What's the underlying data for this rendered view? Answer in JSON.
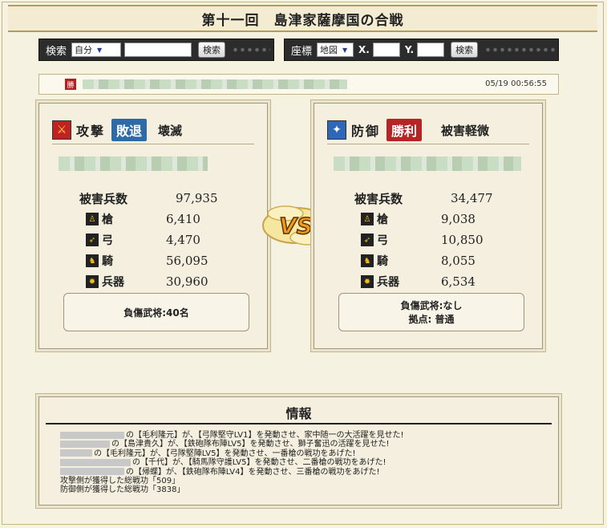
{
  "title": "第十一回　島津家薩摩国の合戦",
  "search": {
    "label": "検索",
    "select_value": "自分",
    "button": "検索"
  },
  "coord_search": {
    "label": "座標",
    "select_value": "地図",
    "x_label": "X.",
    "y_label": "Y.",
    "button": "検索"
  },
  "result_line": {
    "badge": "勝",
    "timestamp": "05/19 00:56:55"
  },
  "attack": {
    "label": "攻撃",
    "result": "敗退",
    "status": "壊滅",
    "result_color": "#2d6aa8",
    "casualties_label": "被害兵数",
    "casualties": "97,935",
    "units": [
      {
        "icon": "spear-icon",
        "name": "槍",
        "value": "6,410"
      },
      {
        "icon": "bow-icon",
        "name": "弓",
        "value": "4,470"
      },
      {
        "icon": "horse-icon",
        "name": "騎",
        "value": "56,095"
      },
      {
        "icon": "siege-icon",
        "name": "兵器",
        "value": "30,960"
      }
    ],
    "injured": "負傷武将:40名"
  },
  "defense": {
    "label": "防御",
    "result": "勝利",
    "status": "被害軽微",
    "result_color": "#b52525",
    "casualties_label": "被害兵数",
    "casualties": "34,477",
    "units": [
      {
        "icon": "spear-icon",
        "name": "槍",
        "value": "9,038"
      },
      {
        "icon": "bow-icon",
        "name": "弓",
        "value": "10,850"
      },
      {
        "icon": "horse-icon",
        "name": "騎",
        "value": "8,055"
      },
      {
        "icon": "siege-icon",
        "name": "兵器",
        "value": "6,534"
      }
    ],
    "injured": "負傷武将:なし",
    "base": "拠点: 普通"
  },
  "vs_text": "VS",
  "info": {
    "title": "情報",
    "lines": [
      "の【毛利隆元】が、【弓隊堅守LV1】を発動させ、家中随一の大活躍を見せた!",
      "の【島津貴久】が、【鉄砲隊布陣LV5】を発動させ、獅子奮迅の活躍を見せた!",
      "の【毛利隆元】が、【弓隊堅陣LV5】を発動させ、一番槍の戦功をあげた!",
      "の【千代】が、【騎馬隊守護LV5】を発動させ、二番槍の戦功をあげた!",
      "の【帰蝶】が、【鉄砲隊布陣LV4】を発動させ、三番槍の戦功をあげた!"
    ],
    "attack_merit": "攻撃側が獲得した総戦功「509」",
    "defense_merit": "防御側が獲得した総戦功「3838」"
  }
}
